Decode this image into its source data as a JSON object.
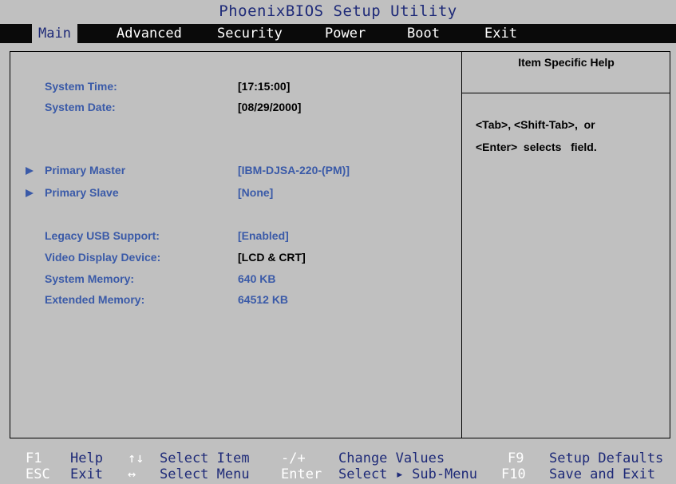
{
  "app_title": "PhoenixBIOS Setup Utility",
  "menu": {
    "items": [
      {
        "label": "Main"
      },
      {
        "label": "Advanced"
      },
      {
        "label": "Security"
      },
      {
        "label": "Power"
      },
      {
        "label": "Boot"
      },
      {
        "label": "Exit"
      }
    ],
    "selected": "Main"
  },
  "main": {
    "system_time": {
      "label": "System Time:",
      "value": "[17:15:00]"
    },
    "system_date": {
      "label": "System Date:",
      "value": "[08/29/2000]"
    },
    "primary_master": {
      "label": "Primary Master",
      "value": "[IBM-DJSA-220-(PM)]"
    },
    "primary_slave": {
      "label": "Primary Slave",
      "value": "[None]"
    },
    "legacy_usb": {
      "label": "Legacy USB Support:",
      "value": "[Enabled]"
    },
    "video_display": {
      "label": "Video Display Device:",
      "value": "[LCD & CRT]"
    },
    "system_memory": {
      "label": "System Memory:",
      "value": "640  KB"
    },
    "extended_memory": {
      "label": "Extended Memory:",
      "value": "64512  KB"
    }
  },
  "help": {
    "title": "Item Specific Help",
    "line1": "<Tab>, <Shift-Tab>,  or",
    "line2": "<Enter>  selects   field."
  },
  "footer": {
    "f1_key": "F1",
    "f1_desc": "Help",
    "arrows_ud_key": "↑↓",
    "arrows_ud_desc": "Select Item",
    "minus_plus_key": "-/+",
    "minus_plus_desc": "Change Values",
    "f9_key": "F9",
    "f9_desc": "Setup Defaults",
    "esc_key": "ESC",
    "esc_desc": "Exit",
    "arrows_lr_key": "↔",
    "arrows_lr_desc": "Select Menu",
    "enter_key": "Enter",
    "enter_desc": "Select ▸ Sub-Menu",
    "f10_key": "F10",
    "f10_desc": "Save and Exit"
  },
  "colors": {
    "background": "#c0c0c0",
    "menubar": "#0a0a0a",
    "label_blue": "#3a5aa8",
    "title_navy": "#1e2a78"
  }
}
